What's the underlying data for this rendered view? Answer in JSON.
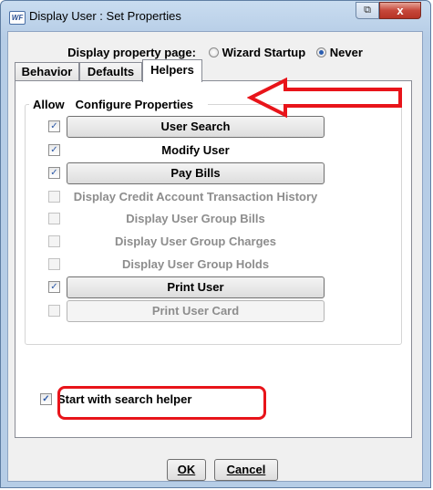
{
  "window": {
    "title": "Display User : Set Properties",
    "app_icon_text": "WF",
    "restore_label": "⧉",
    "close_label": "x"
  },
  "property_page": {
    "label": "Display property page:",
    "options": [
      {
        "label": "Wizard Startup",
        "selected": false
      },
      {
        "label": "Never",
        "selected": true
      }
    ]
  },
  "tabs": [
    {
      "label": "Behavior",
      "active": false
    },
    {
      "label": "Defaults",
      "active": false
    },
    {
      "label": "Helpers",
      "active": true
    }
  ],
  "group": {
    "allow_header": "Allow",
    "configure_header": "Configure Properties"
  },
  "helpers": [
    {
      "label": "User Search",
      "checked": true,
      "enabled": true,
      "style": "button"
    },
    {
      "label": "Modify User",
      "checked": true,
      "enabled": true,
      "style": "plain"
    },
    {
      "label": "Pay Bills",
      "checked": true,
      "enabled": true,
      "style": "button"
    },
    {
      "label": "Display Credit Account Transaction History",
      "checked": false,
      "enabled": false,
      "style": "plain"
    },
    {
      "label": "Display User Group Bills",
      "checked": false,
      "enabled": false,
      "style": "plain"
    },
    {
      "label": "Display User Group Charges",
      "checked": false,
      "enabled": false,
      "style": "plain"
    },
    {
      "label": "Display User Group Holds",
      "checked": false,
      "enabled": false,
      "style": "plain"
    },
    {
      "label": "Print User",
      "checked": true,
      "enabled": true,
      "style": "button"
    },
    {
      "label": "Print User Card",
      "checked": false,
      "enabled": false,
      "style": "button"
    }
  ],
  "search_helper": {
    "label": "Start with search helper",
    "checked": true
  },
  "buttons": {
    "ok": "OK",
    "cancel": "Cancel"
  },
  "colors": {
    "annotation": "#e8141a",
    "accent": "#2a5db0"
  }
}
